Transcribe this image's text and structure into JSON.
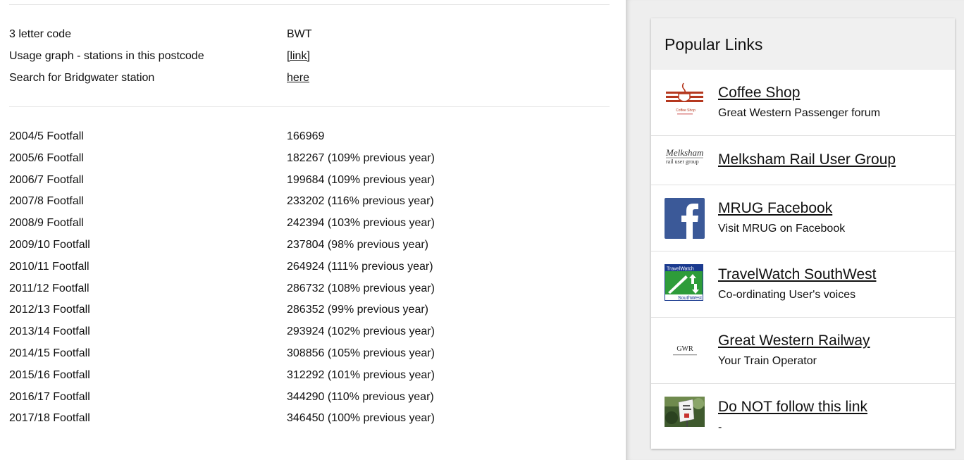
{
  "info_rows": [
    {
      "label": "3 letter code",
      "value": "BWT"
    },
    {
      "label": "Usage graph - stations in this postcode",
      "value": "[link]"
    },
    {
      "label": "Search for Bridgwater station",
      "value": "here"
    }
  ],
  "footfall_rows": [
    {
      "label": "2004/5 Footfall",
      "value": "166969"
    },
    {
      "label": "2005/6 Footfall",
      "value": "182267 (109% previous year)"
    },
    {
      "label": "2006/7 Footfall",
      "value": "199684 (109% previous year)"
    },
    {
      "label": "2007/8 Footfall",
      "value": "233202 (116% previous year)"
    },
    {
      "label": "2008/9 Footfall",
      "value": "242394 (103% previous year)"
    },
    {
      "label": "2009/10 Footfall",
      "value": "237804 (98% previous year)"
    },
    {
      "label": "2010/11 Footfall",
      "value": "264924 (111% previous year)"
    },
    {
      "label": "2011/12 Footfall",
      "value": "286732 (108% previous year)"
    },
    {
      "label": "2012/13 Footfall",
      "value": "286352 (99% previous year)"
    },
    {
      "label": "2013/14 Footfall",
      "value": "293924 (102% previous year)"
    },
    {
      "label": "2014/15 Footfall",
      "value": "308856 (105% previous year)"
    },
    {
      "label": "2015/16 Footfall",
      "value": "312292 (101% previous year)"
    },
    {
      "label": "2016/17 Footfall",
      "value": "344290 (110% previous year)"
    },
    {
      "label": "2017/18 Footfall",
      "value": "346450 (100% previous year)"
    }
  ],
  "sidebar": {
    "title": "Popular Links",
    "links": [
      {
        "title": "Coffee Shop",
        "subtitle": "Great Western Passenger forum",
        "icon": "coffee-cup-logo",
        "logo_text": "Coffee Shop"
      },
      {
        "title": "Melksham Rail User Group",
        "subtitle": "",
        "icon": "mrug-logo",
        "logo_text": "Melksham rail user group"
      },
      {
        "title": "MRUG Facebook",
        "subtitle": "Visit MRUG on Facebook",
        "icon": "facebook-logo"
      },
      {
        "title": "TravelWatch SouthWest",
        "subtitle": "Co-ordinating User's voices",
        "icon": "travelwatch-logo",
        "logo_text_top": "TravelWatch",
        "logo_text_bottom": "SouthWest"
      },
      {
        "title": "Great Western Railway",
        "subtitle": "Your Train Operator",
        "icon": "gwr-logo",
        "logo_text": "GWR"
      },
      {
        "title": "Do NOT follow this link",
        "subtitle": "-",
        "icon": "station-sign-photo"
      }
    ]
  },
  "colors": {
    "facebook": "#3b5998",
    "travelwatch_blue": "#1a3a8f",
    "travelwatch_green": "#2e9c3a",
    "coffee_red": "#b5381f"
  }
}
